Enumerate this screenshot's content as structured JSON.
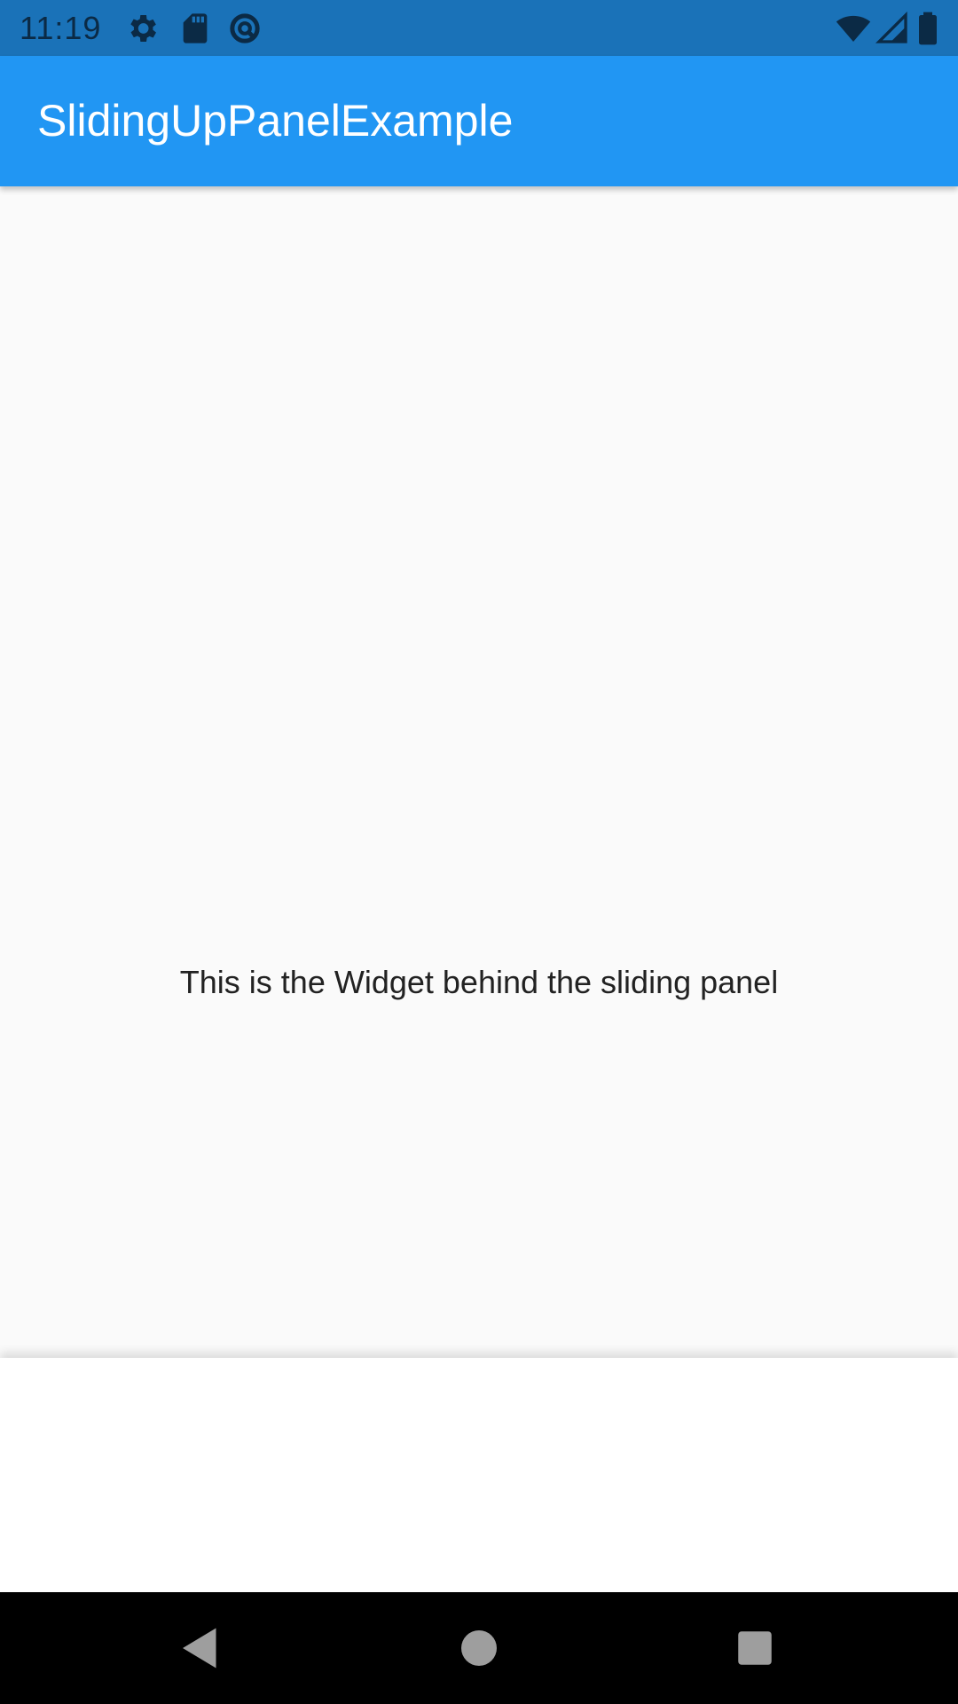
{
  "status_bar": {
    "time": "11:19",
    "icons": [
      "settings-icon",
      "sd-card-icon",
      "data-saver-icon",
      "wifi-icon",
      "signal-icon",
      "battery-icon"
    ],
    "background": "#1a72b8"
  },
  "app_bar": {
    "title": "SlidingUpPanelExample",
    "background": "#2196f3"
  },
  "body": {
    "text": "This is the Widget behind the sliding panel",
    "background": "#fafafa"
  },
  "sliding_panel": {
    "background": "#ffffff"
  },
  "nav_bar": {
    "buttons": [
      "back-icon",
      "home-icon",
      "recents-icon"
    ],
    "background": "#000000"
  }
}
